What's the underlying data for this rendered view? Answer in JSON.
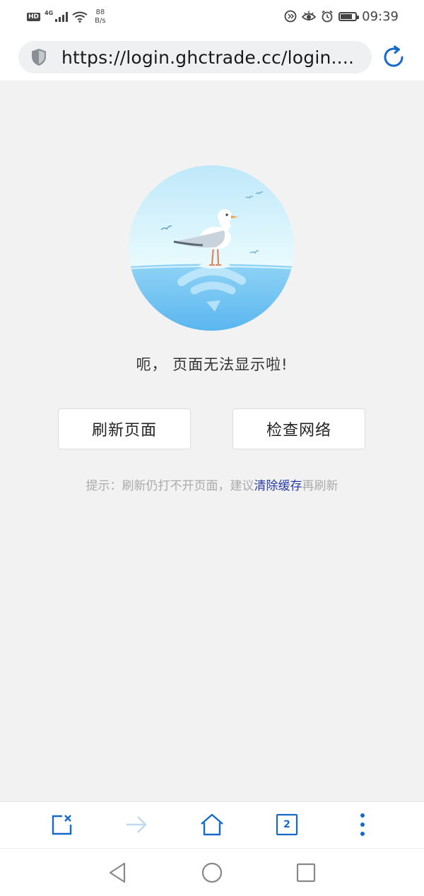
{
  "status_bar": {
    "hd": "HD",
    "network": "4G",
    "speed_value": "88",
    "speed_unit": "B/s",
    "time": "09:39",
    "icons": [
      "data-saver-icon",
      "eye-icon",
      "alarm-icon",
      "battery-icon"
    ]
  },
  "address_bar": {
    "url": "https://login.ghctrade.cc/login....",
    "icons": [
      "shield-icon",
      "reload-icon"
    ]
  },
  "error_page": {
    "message": "呃， 页面无法显示啦!",
    "refresh_button": "刷新页面",
    "check_network_button": "检查网络",
    "hint_prefix": "提示：刷新仍打不开页面，建议",
    "hint_link": "清除缓存",
    "hint_suffix": "再刷新",
    "illustration": "seagull-on-wifi-wave"
  },
  "toolbar": {
    "tabs_count": "2",
    "icons": [
      "close-page-icon",
      "forward-icon",
      "home-icon",
      "tabs-icon",
      "more-menu-icon"
    ]
  },
  "nav_bar": {
    "icons": [
      "back-triangle-icon",
      "home-circle-icon",
      "recents-square-icon"
    ]
  },
  "colors": {
    "accent": "#1769c8",
    "link": "#2c3ea8",
    "page_bg": "#f2f2f2",
    "sky": "#d6f2fb",
    "sea": "#6fc3f3"
  }
}
